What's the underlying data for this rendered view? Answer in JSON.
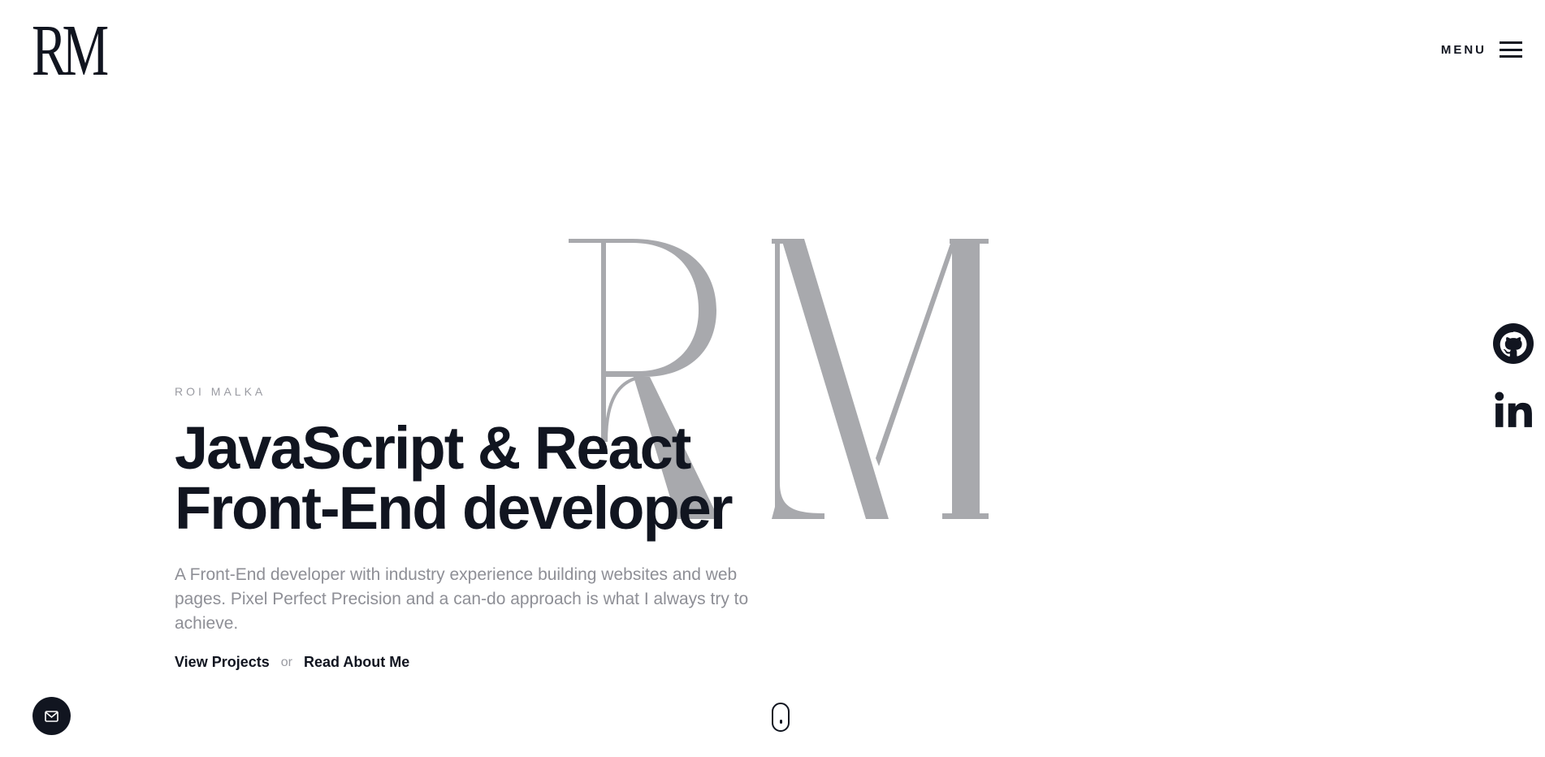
{
  "header": {
    "logo_text": "RM",
    "menu_label": "MENU"
  },
  "monogram": {
    "text": "RM",
    "color": "#a8a9ad"
  },
  "hero": {
    "eyebrow": "ROI MALKA",
    "headline_line1": "JavaScript & React",
    "headline_line2": "Front-End developer",
    "description": "A Front-End developer with industry experience building websites and web pages. Pixel Perfect Precision and a can-do approach is what I always try to achieve.",
    "cta_primary": "View Projects",
    "cta_separator": "or",
    "cta_secondary": "Read About Me"
  },
  "social": {
    "items": [
      {
        "icon": "github-icon"
      },
      {
        "icon": "linkedin-icon"
      }
    ]
  },
  "floating": {
    "mail_icon": "mail-icon",
    "scroll_icon": "mouse-scroll-icon"
  },
  "colors": {
    "text_dark": "#111520",
    "text_muted": "#8e8f96",
    "monogram_gray": "#a8a9ad"
  }
}
